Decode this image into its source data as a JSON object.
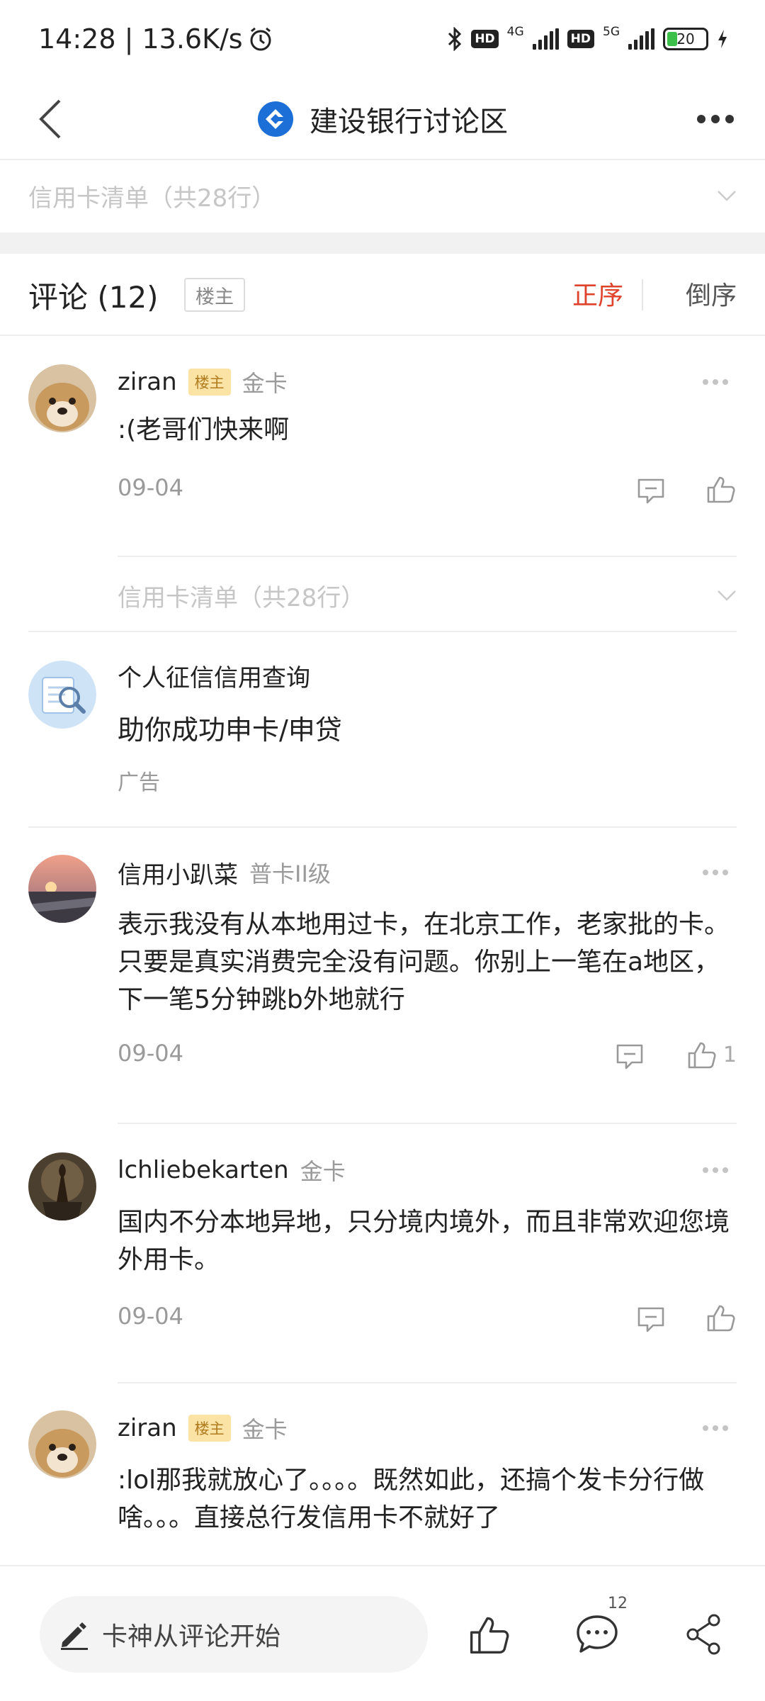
{
  "status_bar": {
    "time_speed": "14:28 | 13.6K/s",
    "hd1": "HD",
    "net1": "4G",
    "hd2": "HD",
    "net2": "5G",
    "battery": "20"
  },
  "header": {
    "title": "建设银行讨论区",
    "brand_color": "#1b6fd6"
  },
  "top_collapse": {
    "label": "信用卡清单（共28行）"
  },
  "comments_header": {
    "title": "评论 (12)",
    "op_only": "楼主",
    "sort_asc": "正序",
    "sort_desc": "倒序",
    "active_sort_color": "#e0432c"
  },
  "comments": [
    {
      "name": "ziran",
      "op_tag": "楼主",
      "rank": "金卡",
      "text": ":(老哥们快来啊",
      "date": "09-04",
      "likes": "",
      "collapse_label": "信用卡清单（共28行）"
    },
    {
      "name": "信用小趴菜",
      "op_tag": "",
      "rank": "普卡II级",
      "text": "表示我没有从本地用过卡，在北京工作，老家批的卡。只要是真实消费完全没有问题。你别上一笔在a地区，下一笔5分钟跳b外地就行",
      "date": "09-04",
      "likes": "1"
    },
    {
      "name": "lchliebekarten",
      "op_tag": "",
      "rank": "金卡",
      "text": "国内不分本地异地，只分境内境外，而且非常欢迎您境外用卡。",
      "date": "09-04",
      "likes": ""
    },
    {
      "name": "ziran",
      "op_tag": "楼主",
      "rank": "金卡",
      "text": ":lol那我就放心了。。。。既然如此，还搞个发卡分行做啥。。。直接总行发信用卡不就好了",
      "date": "",
      "likes": ""
    }
  ],
  "ad": {
    "title": "个人征信信用查询",
    "text": "助你成功申卡/申贷",
    "label": "广告"
  },
  "bottom_bar": {
    "input_placeholder": "卡神从评论开始",
    "comment_count": "12"
  }
}
